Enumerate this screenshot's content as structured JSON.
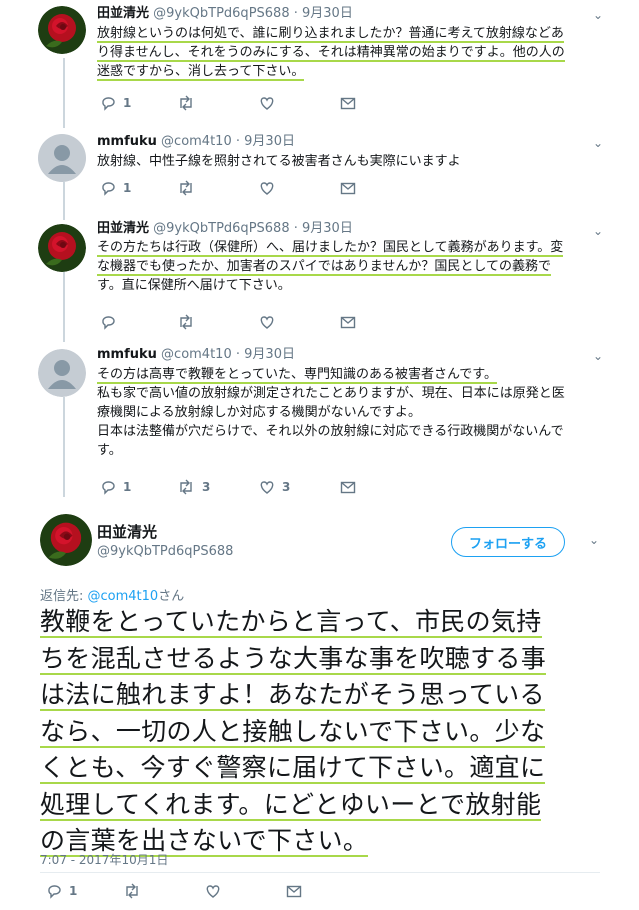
{
  "thread": [
    {
      "avatar": "rose-avatar",
      "name": "田並清光",
      "handle": "@9ykQbTPd6qPS688",
      "date": "9月30日",
      "lines": [
        "放射線というのは何処で、誰に刷り込まれましたか？普通に考えて放射線などあ",
        "り得ませんし、それをうのみにする、それは精神異常の始まりですよ。他の人の",
        "迷惑ですから、消し去って下さい。"
      ],
      "reply_count": "1",
      "retweet_count": "",
      "like_count": ""
    },
    {
      "avatar": "default-avatar",
      "name": "mmfuku",
      "handle": "@com4t10",
      "date": "9月30日",
      "lines": [
        "放射線、中性子線を照射されてる被害者さんも実際にいますよ"
      ],
      "reply_count": "1",
      "retweet_count": "",
      "like_count": ""
    },
    {
      "avatar": "rose-avatar",
      "name": "田並清光",
      "handle": "@9ykQbTPd6qPS688",
      "date": "9月30日",
      "lines": [
        "その方たちは行政（保健所）へ、届けましたか？国民として義務があります。変",
        "な機器でも使ったか、加害者のスパイではありませんか？国民としての義務で",
        "す。直に保健所へ届けて下さい。"
      ],
      "reply_count": "",
      "retweet_count": "",
      "like_count": ""
    },
    {
      "avatar": "default-avatar",
      "name": "mmfuku",
      "handle": "@com4t10",
      "date": "9月30日",
      "lines": [
        "その方は高専で教鞭をとっていた、専門知識のある被害者さんです。",
        "私も家で高い値の放射線が測定されたことありますが、現在、日本には原発と医",
        "療機関による放射線しか対応する機関がないんですよ。",
        "日本は法整備が穴だらけで、それ以外の放射線に対応できる行政機関がないんで",
        "す。"
      ],
      "reply_count": "1",
      "retweet_count": "3",
      "like_count": "3"
    }
  ],
  "main_tweet": {
    "name": "田並清光",
    "handle": "@9ykQbTPd6qPS688",
    "follow_label": "フォローする",
    "reply_to_prefix": "返信先: ",
    "reply_to_handle": "@com4t10",
    "reply_to_suffix": "さん",
    "lines": [
      "教鞭をとっていたからと言って、市民の気持",
      "ちを混乱させるような大事な事を吹聴する事",
      "は法に触れますよ！あなたがそう思っている",
      "なら、一切の人と接触しないで下さい。少な",
      "くとも、今すぐ警察に届けて下さい。適宜に",
      "処理してくれます。にどとゆいーとで放射能",
      "の言葉を出さないで下さい。"
    ],
    "timestamp": "7:07 - 2017年10月1日",
    "reply_count": "1"
  },
  "colors": {
    "accent": "#1da1f2",
    "highlight": "#a8d84a",
    "muted": "#657786",
    "rose": "#c8102e"
  }
}
